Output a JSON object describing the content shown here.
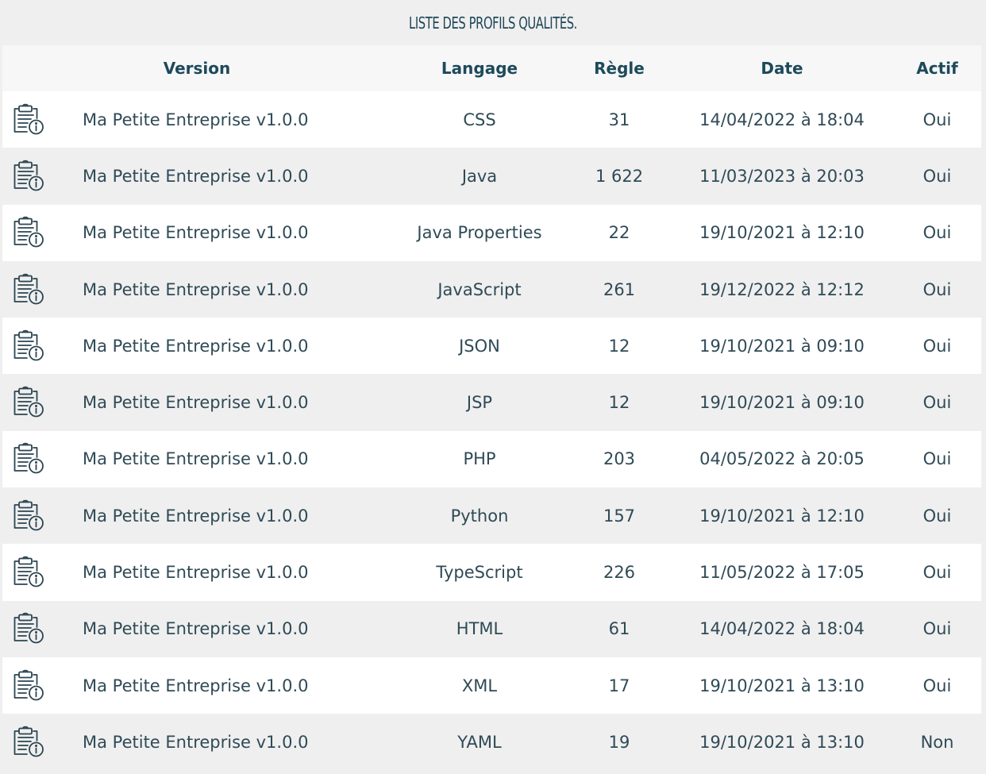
{
  "title": "Liste des profils qualités.",
  "columns": {
    "version": "Version",
    "language": "Langage",
    "rules": "Règle",
    "date": "Date",
    "active": "Actif"
  },
  "row_icon": "clipboard-info-icon",
  "rows": [
    {
      "version": "Ma Petite Entreprise v1.0.0",
      "language": "CSS",
      "rules": "31",
      "date": "14/04/2022 à 18:04",
      "active": "Oui"
    },
    {
      "version": "Ma Petite Entreprise v1.0.0",
      "language": "Java",
      "rules": "1 622",
      "date": "11/03/2023 à 20:03",
      "active": "Oui"
    },
    {
      "version": "Ma Petite Entreprise v1.0.0",
      "language": "Java Properties",
      "rules": "22",
      "date": "19/10/2021 à 12:10",
      "active": "Oui"
    },
    {
      "version": "Ma Petite Entreprise v1.0.0",
      "language": "JavaScript",
      "rules": "261",
      "date": "19/12/2022 à 12:12",
      "active": "Oui"
    },
    {
      "version": "Ma Petite Entreprise v1.0.0",
      "language": "JSON",
      "rules": "12",
      "date": "19/10/2021 à 09:10",
      "active": "Oui"
    },
    {
      "version": "Ma Petite Entreprise v1.0.0",
      "language": "JSP",
      "rules": "12",
      "date": "19/10/2021 à 09:10",
      "active": "Oui"
    },
    {
      "version": "Ma Petite Entreprise v1.0.0",
      "language": "PHP",
      "rules": "203",
      "date": "04/05/2022 à 20:05",
      "active": "Oui"
    },
    {
      "version": "Ma Petite Entreprise v1.0.0",
      "language": "Python",
      "rules": "157",
      "date": "19/10/2021 à 12:10",
      "active": "Oui"
    },
    {
      "version": "Ma Petite Entreprise v1.0.0",
      "language": "TypeScript",
      "rules": "226",
      "date": "11/05/2022 à 17:05",
      "active": "Oui"
    },
    {
      "version": "Ma Petite Entreprise v1.0.0",
      "language": "HTML",
      "rules": "61",
      "date": "14/04/2022 à 18:04",
      "active": "Oui"
    },
    {
      "version": "Ma Petite Entreprise v1.0.0",
      "language": "XML",
      "rules": "17",
      "date": "19/10/2021 à 13:10",
      "active": "Oui"
    },
    {
      "version": "Ma Petite Entreprise v1.0.0",
      "language": "YAML",
      "rules": "19",
      "date": "19/10/2021 à 13:10",
      "active": "Non"
    }
  ]
}
